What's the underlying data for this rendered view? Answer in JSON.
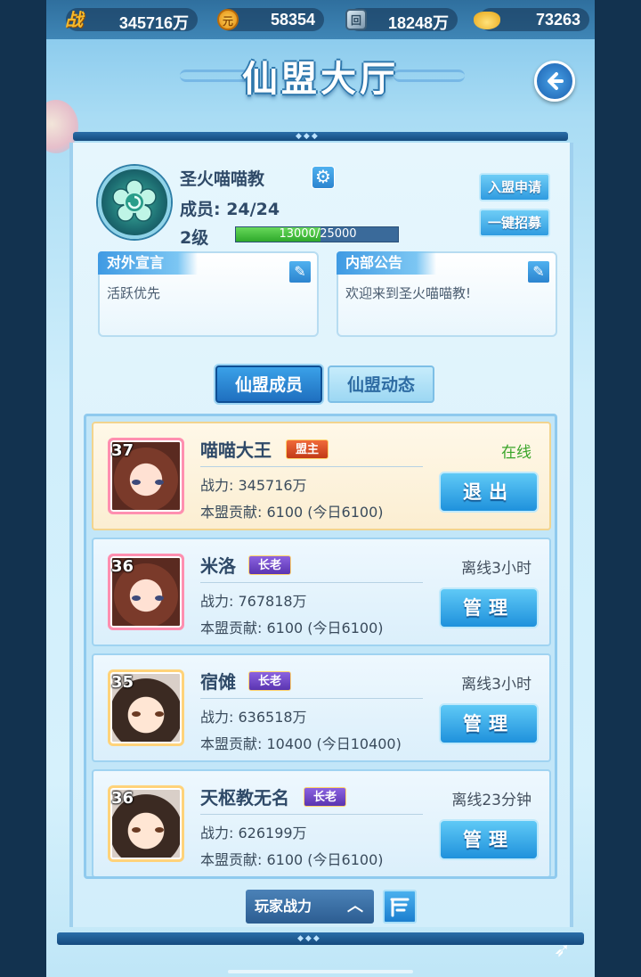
{
  "currency": {
    "power_icon": "战",
    "power": "345716万",
    "coin_icon": "元",
    "coin": "58354",
    "token_icon": "回",
    "token": "18248万",
    "ingot": "73263"
  },
  "header": {
    "title": "仙盟大厅"
  },
  "guild": {
    "name": "圣火喵喵教",
    "members": "成员: 24/24",
    "level": "2级",
    "exp": 13000,
    "exp_max": 25000,
    "exp_text": "13000/25000",
    "exp_fraction": 0.52
  },
  "actions": {
    "apply": "入盟申请",
    "recruit": "一键招募"
  },
  "notes": {
    "public": {
      "title": "对外宣言",
      "text": "活跃优先"
    },
    "internal": {
      "title": "内部公告",
      "text": "欢迎来到圣火喵喵教!"
    }
  },
  "tabs": {
    "members": "仙盟成员",
    "news": "仙盟动态"
  },
  "members": [
    {
      "level": "37",
      "name": "喵喵大王",
      "rank": "盟主",
      "power": "战力: 345716万",
      "contrib": "本盟贡献: 6100 (今日6100)",
      "status": "在线",
      "action": "退出"
    },
    {
      "level": "36",
      "name": "米洛",
      "rank": "长老",
      "power": "战力: 767818万",
      "contrib": "本盟贡献: 6100 (今日6100)",
      "status": "离线3小时",
      "action": "管理"
    },
    {
      "level": "35",
      "name": "宿傩",
      "rank": "长老",
      "power": "战力: 636518万",
      "contrib": "本盟贡献: 10400 (今日10400)",
      "status": "离线3小时",
      "action": "管理"
    },
    {
      "level": "36",
      "name": "天枢教无名",
      "rank": "长老",
      "power": "战力: 626199万",
      "contrib": "本盟贡献: 6100 (今日6100)",
      "status": "离线23分钟",
      "action": "管理"
    }
  ],
  "sort": {
    "label": "玩家战力"
  },
  "colors": {
    "accent": "#2f9be0",
    "online": "#3aa52a",
    "leader_badge": "#c23a17",
    "elder_badge": "#5a34b0"
  }
}
